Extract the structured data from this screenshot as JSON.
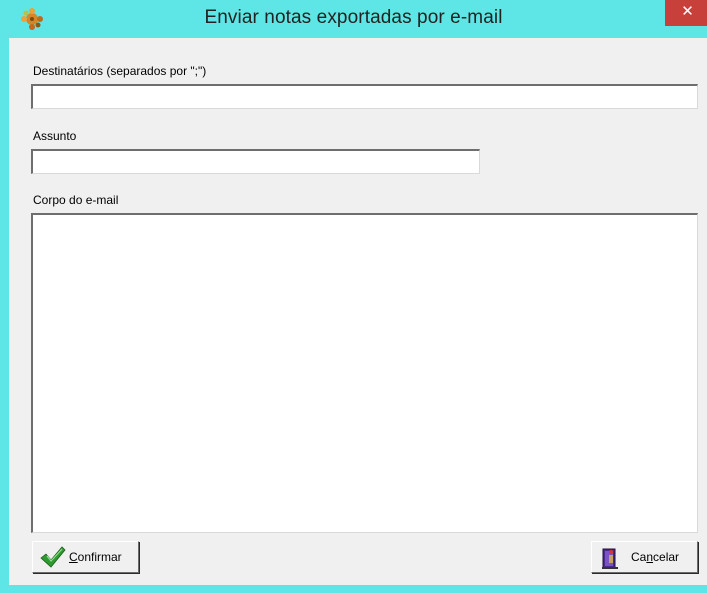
{
  "window": {
    "title": "Enviar notas exportadas por e-mail",
    "close_glyph": "✕",
    "app_icon": "puzzle-gear-icon"
  },
  "form": {
    "recipients_label": "Destinatários (separados por \";\")",
    "recipients_value": "",
    "subject_label": "Assunto",
    "subject_value": "",
    "body_label": "Corpo do e-mail",
    "body_value": ""
  },
  "buttons": {
    "confirm_label": "Confirmar",
    "confirm_mnemonic": "C",
    "confirm_rest": "onfirmar",
    "confirm_icon": "checkmark-icon",
    "cancel_label": "Cancelar",
    "cancel_prefix": "Ca",
    "cancel_mnemonic": "n",
    "cancel_rest": "celar",
    "cancel_icon": "exit-door-icon"
  },
  "colors": {
    "titlebar": "#5ee6e6",
    "close_button": "#c7403a",
    "client_bg": "#f0f0f0"
  }
}
